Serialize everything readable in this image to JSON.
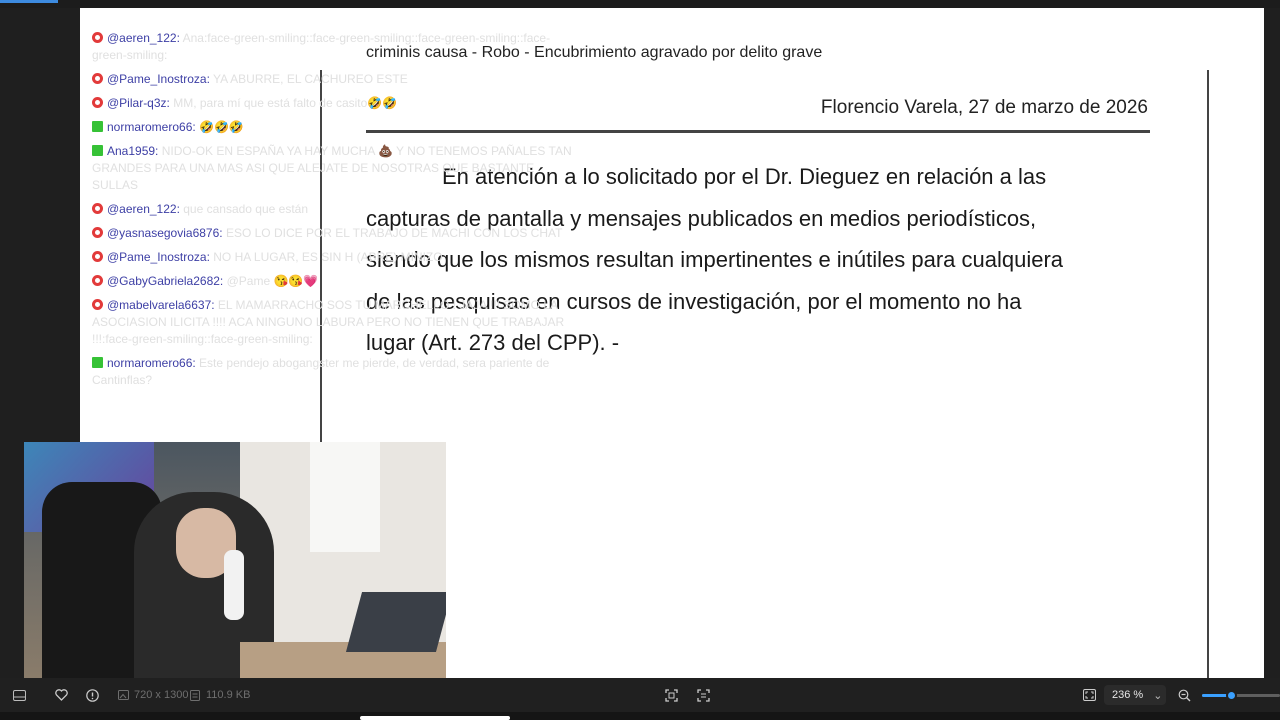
{
  "document": {
    "header": "criminis causa - Robo - Encubrimiento agravado por delito grave",
    "date": "Florencio Varela, 27  de  marzo  de  2026",
    "paragraph": [
      "En atención a lo solicitado por el Dr. Dieguez en relación a las",
      "capturas de pantalla y mensajes publicados en medios periodísticos,",
      "siendo que los mismos resultan impertinentes e inútiles para cualquiera",
      "de las pesquisas en cursos de investigación, por el momento no ha",
      "lugar (Art. 273 del CPP). -"
    ]
  },
  "chat": [
    {
      "platform": "youtube",
      "user": "@aeren_122",
      "text": "Ana:face-green-smiling::face-green-smiling::face-green-smiling::face-green-smiling:"
    },
    {
      "platform": "youtube",
      "user": "@Pame_Inostroza",
      "text": "YA ABURRE, EL CACHUREO ESTE"
    },
    {
      "platform": "youtube",
      "user": "@Pilar-q3z",
      "text": "MM, para mí que está falto de casito🤣🤣"
    },
    {
      "platform": "kick",
      "user": "normaromero66",
      "text": "🤣🤣🤣"
    },
    {
      "platform": "kick",
      "user": "Ana1959",
      "text": "NIDO-OK EN ESPAÑA YA HAY MUCHA 💩 Y NO TENEMOS PAÑALES TAN GRANDES PARA UNA MAS ASI QUE ALEJATE DE NOSOTRAS QUE BASTANTE SULLAS"
    },
    {
      "platform": "youtube",
      "user": "@aeren_122",
      "text": "que cansado que están"
    },
    {
      "platform": "youtube",
      "user": "@yasnasegovia6876",
      "text": "ESO LO DICE POR EL TRABAJO DE MACHI CON LOS CHAT"
    },
    {
      "platform": "youtube",
      "user": "@Pame_Inostroza",
      "text": "NO HA LUGAR, ES SIN H (ABRE) MINIZO"
    },
    {
      "platform": "youtube",
      "user": "@GabyGabriela2682",
      "text": "@Pame 😘😘💗"
    },
    {
      "platform": "youtube",
      "user": "@mabelvarela6637",
      "text": "EL MAMARRACHO SOS TU MARCHELLO ! JAJA !!! SOMO LA ASOCIASION ILICITA !!!! ACA NINGUNO LABURA PERO NO TIENEN QUE TRABAJAR !!!:face-green-smiling::face-green-smiling:"
    },
    {
      "platform": "kick",
      "user": "normaromero66",
      "text": "Este pendejo abogangster me pierde, de verdad, sera pariente de Cantinflas?"
    }
  ],
  "statusbar": {
    "dimensions": "720 x 1300",
    "file_size": "110.9 KB",
    "zoom": "236 %",
    "zoom_level_fraction": 0.37
  },
  "icons": {
    "minimize": "window-icon",
    "favorite": "heart-icon",
    "info": "info-icon",
    "dims": "image-dims-icon",
    "size": "file-size-icon",
    "fit": "fit-screen-icon",
    "crop": "crop-icon",
    "fullscreen": "fullscreen-icon",
    "zoom_out": "zoom-out-icon"
  },
  "colors": {
    "accent": "#3aa0ff",
    "youtube": "#e23a3a",
    "kick": "#36c236",
    "username": "#3d3fa5"
  }
}
